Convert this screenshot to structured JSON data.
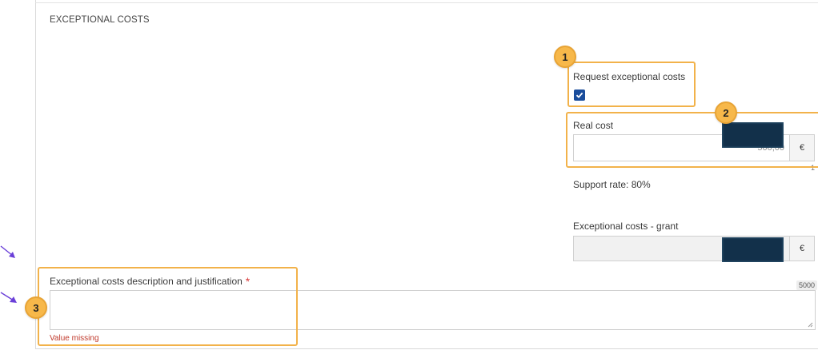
{
  "section": {
    "title": "EXCEPTIONAL COSTS"
  },
  "request": {
    "label": "Request exceptional costs",
    "checked": true
  },
  "real_cost": {
    "label": "Real cost",
    "value": "500,00",
    "currency": "€",
    "side_mark": "1"
  },
  "support_rate": {
    "text": "Support rate: 80%"
  },
  "grant": {
    "label": "Exceptional costs - grant",
    "currency": "€"
  },
  "description": {
    "label": "Exceptional costs description and justification",
    "required_mark": "*",
    "char_counter": "5000",
    "error": "Value missing"
  },
  "annotations": {
    "badges": [
      "1",
      "2",
      "3"
    ],
    "highlight_color": "#f2b24a",
    "arrow_color": "#6a3fd8"
  },
  "colors": {
    "checkbox": "#1a4d9c",
    "error": "#c0392b",
    "redaction": "#12304a"
  },
  "icons": {
    "check": "check-icon",
    "arrows": "arrow-icon"
  }
}
